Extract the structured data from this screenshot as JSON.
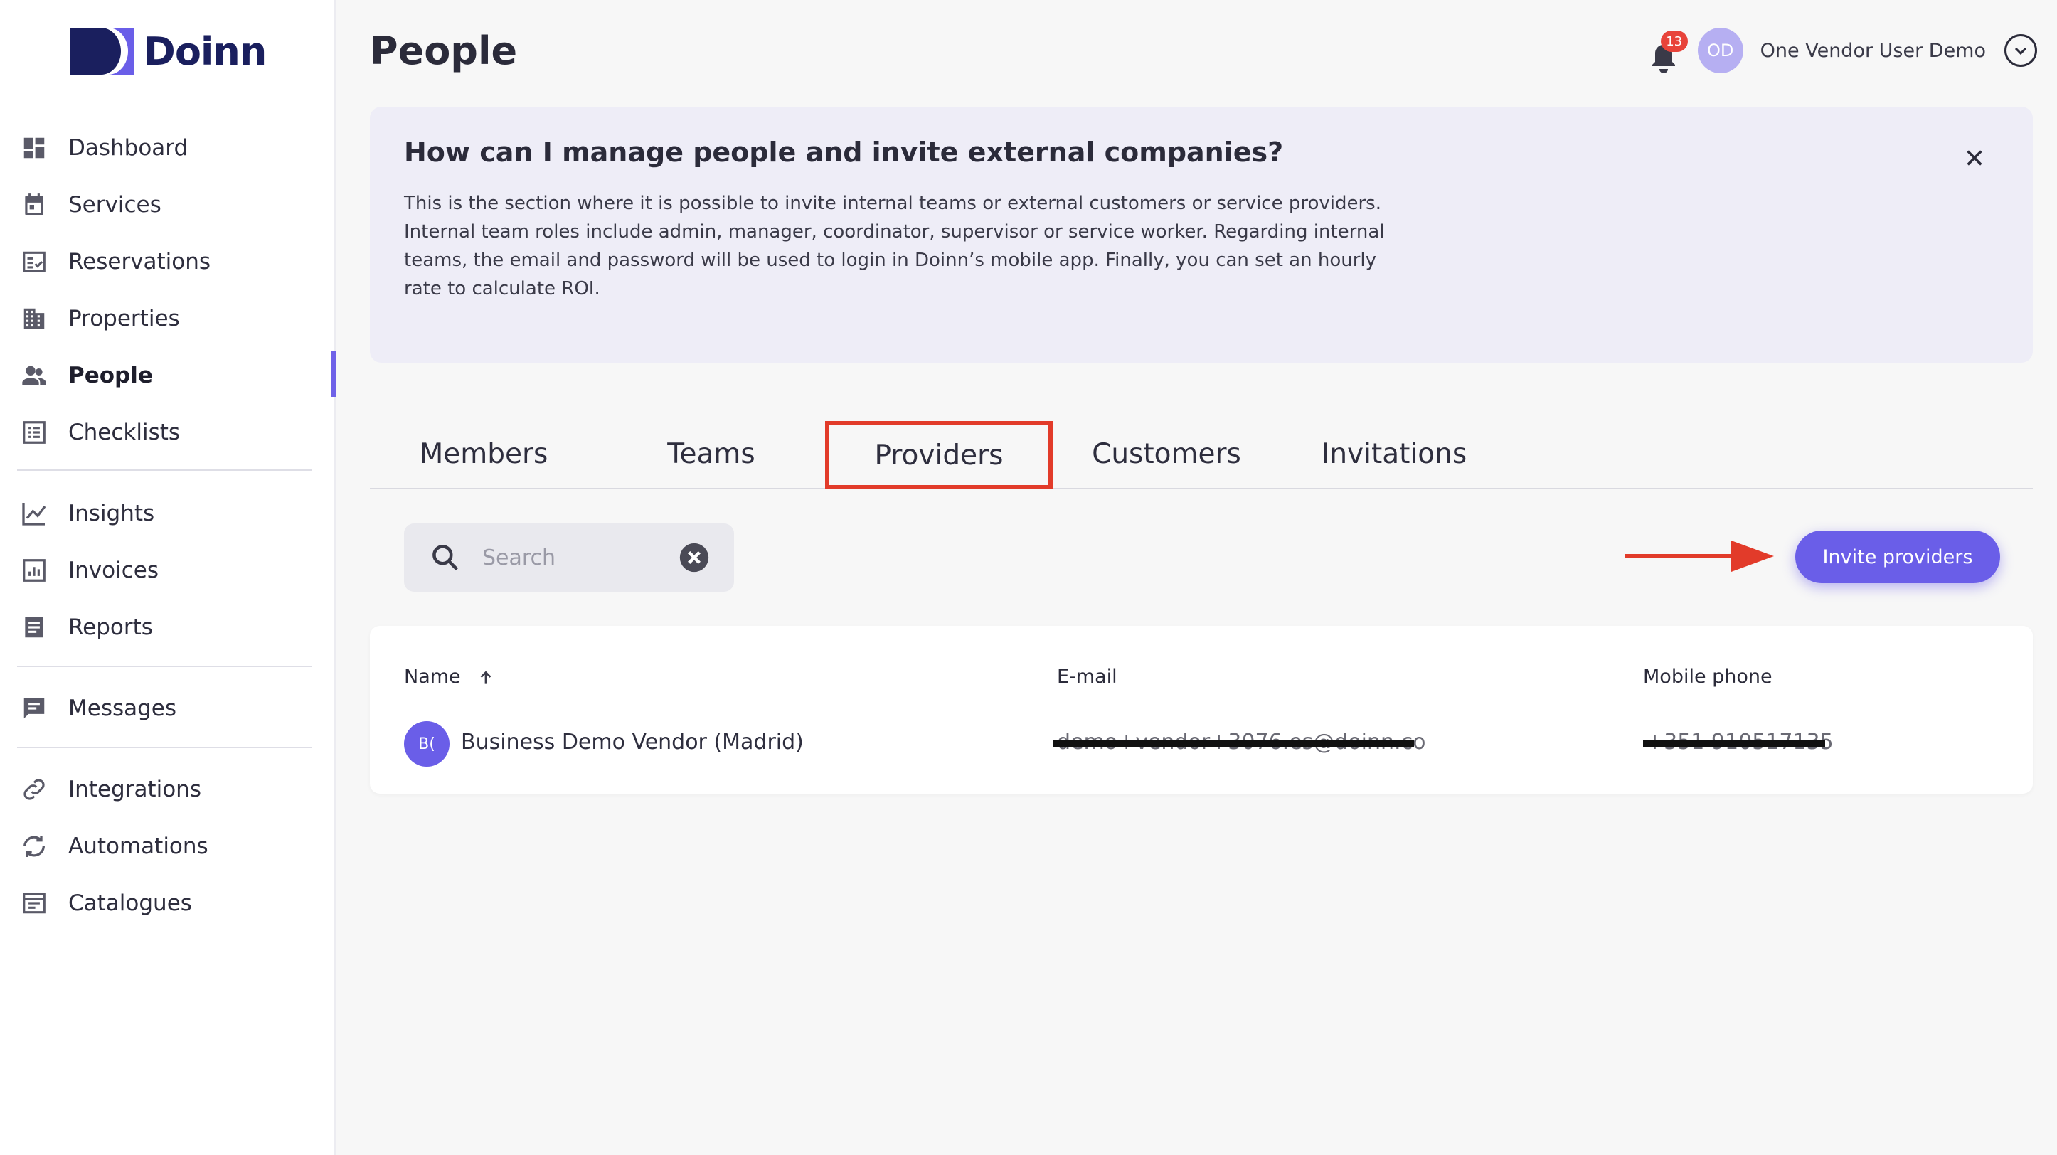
{
  "app": {
    "logo_text": "Doinn",
    "brand_color": "#1a1f5e",
    "accent_color": "#6a5ee8"
  },
  "sidebar": {
    "items": [
      {
        "label": "Dashboard",
        "icon": "dashboard-icon"
      },
      {
        "label": "Services",
        "icon": "calendar-icon"
      },
      {
        "label": "Reservations",
        "icon": "reservations-icon"
      },
      {
        "label": "Properties",
        "icon": "building-icon"
      },
      {
        "label": "People",
        "icon": "people-icon",
        "active": true
      },
      {
        "label": "Checklists",
        "icon": "checklist-icon"
      },
      {
        "label": "Insights",
        "icon": "chart-line-icon"
      },
      {
        "label": "Invoices",
        "icon": "invoice-icon"
      },
      {
        "label": "Reports",
        "icon": "report-icon"
      },
      {
        "label": "Messages",
        "icon": "message-icon"
      },
      {
        "label": "Integrations",
        "icon": "link-icon"
      },
      {
        "label": "Automations",
        "icon": "sync-icon"
      },
      {
        "label": "Catalogues",
        "icon": "catalogue-icon"
      }
    ]
  },
  "header": {
    "title": "People",
    "notifications_count": "13",
    "user_initials": "OD",
    "user_name": "One Vendor User Demo"
  },
  "help": {
    "title": "How can I manage people and invite external companies?",
    "text": "This is the section where it is possible to invite internal teams or external customers or service providers. Internal team roles include admin, manager, coordinator, supervisor or service worker. Regarding internal teams, the email and password will be used to login in Doinn’s mobile app. Finally, you can set an hourly rate to calculate ROI."
  },
  "tabs": [
    {
      "label": "Members"
    },
    {
      "label": "Teams"
    },
    {
      "label": "Providers",
      "selected": true
    },
    {
      "label": "Customers"
    },
    {
      "label": "Invitations"
    }
  ],
  "search": {
    "placeholder": "Search"
  },
  "invite_button": {
    "label": "Invite providers"
  },
  "table": {
    "columns": [
      "Name",
      "E-mail",
      "Mobile phone"
    ],
    "rows": [
      {
        "initials": "B(",
        "name": "Business Demo Vendor (Madrid)",
        "email": "demo+vendor+3076.es@doinn.co",
        "phone": "+351 910517135"
      }
    ]
  },
  "colors": {
    "highlight": "#e23b2a",
    "badge": "#e8433a"
  }
}
